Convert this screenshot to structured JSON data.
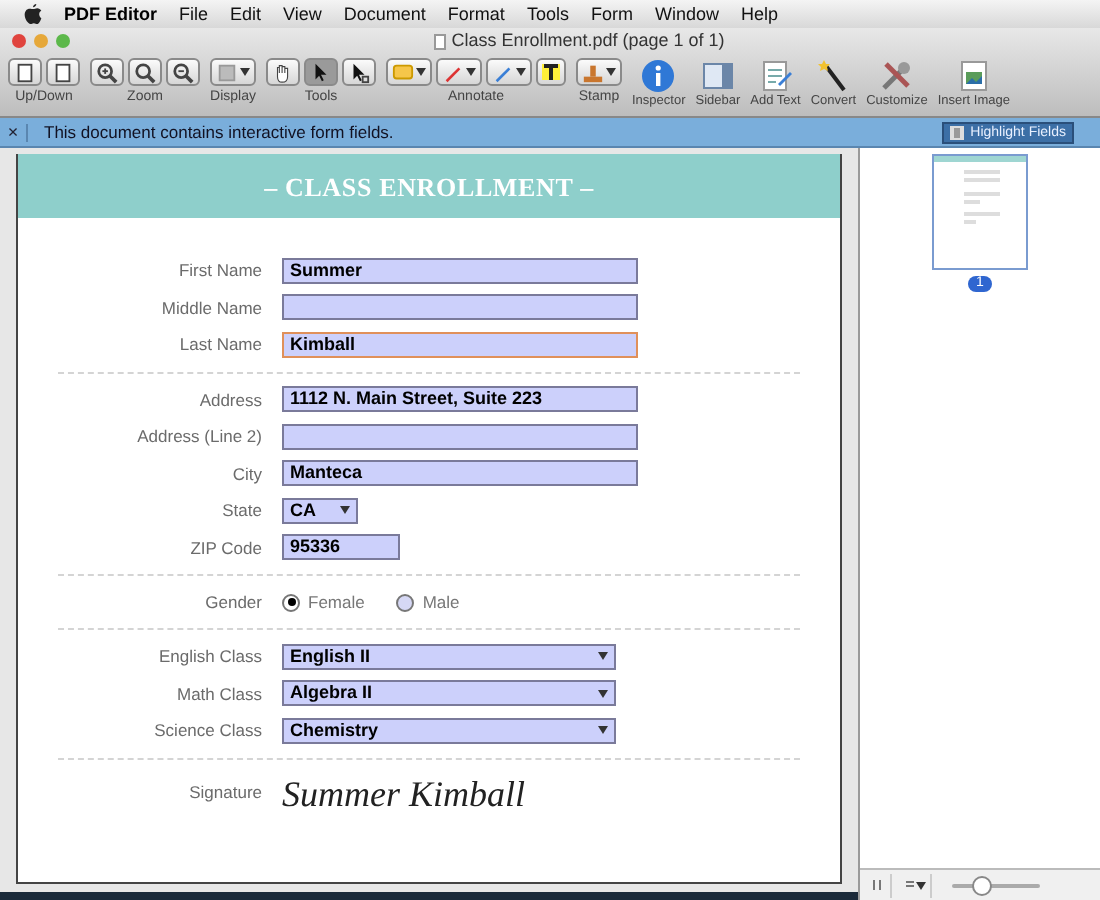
{
  "menu_bar": {
    "items": [
      {
        "label": "PDF Editor",
        "kind": "app"
      },
      {
        "label": "File",
        "kind": "menu"
      },
      {
        "label": "Edit",
        "kind": "menu"
      },
      {
        "label": "View",
        "kind": "menu"
      },
      {
        "label": "Document",
        "kind": "menu"
      },
      {
        "label": "Format",
        "kind": "menu"
      },
      {
        "label": "Tools",
        "kind": "menu"
      },
      {
        "label": "Form",
        "kind": "menu"
      },
      {
        "label": "Window",
        "kind": "menu"
      },
      {
        "label": "Help",
        "kind": "menu"
      }
    ]
  },
  "window": {
    "title": "Class Enrollment.pdf (page 1 of 1)"
  },
  "toolbar": {
    "groups": [
      {
        "label": "Up/Down",
        "kind": "updown",
        "buttons": [
          {
            "selected": false
          },
          {
            "selected": false
          }
        ]
      },
      {
        "label": "Zoom",
        "kind": "zoom",
        "buttons": [
          {
            "selected": false
          },
          {
            "selected": false
          },
          {
            "selected": false
          }
        ]
      },
      {
        "label": "Display",
        "kind": "display",
        "buttons": [
          {
            "selected": false
          }
        ]
      },
      {
        "label": "Tools",
        "kind": "tools",
        "buttons": [
          {
            "selected": false
          },
          {
            "selected": true
          },
          {
            "selected": false
          }
        ]
      },
      {
        "label": "Annotate",
        "kind": "annotate",
        "buttons": [
          {
            "selected": false
          },
          {
            "selected": false
          },
          {
            "selected": false
          },
          {
            "selected": false
          }
        ]
      },
      {
        "label": "Stamp",
        "kind": "stamp",
        "buttons": [
          {
            "selected": false
          }
        ]
      }
    ],
    "actions": [
      {
        "label": "Inspector",
        "kind": "inspector"
      },
      {
        "label": "Sidebar",
        "kind": "sidebar"
      },
      {
        "label": "Add Text",
        "kind": "addtext"
      },
      {
        "label": "Convert",
        "kind": "convert"
      },
      {
        "label": "Customize",
        "kind": "customize"
      },
      {
        "label": "Insert Image",
        "kind": "image"
      }
    ]
  },
  "info_bar": {
    "close": "×",
    "message": "This document contains interactive form fields.",
    "button": "Highlight Fields"
  },
  "form": {
    "title": "– CLASS ENROLLMENT –",
    "sections": [
      [
        {
          "kind": "text",
          "label": "First Name",
          "value": "Summer",
          "focused": false
        },
        {
          "kind": "text",
          "label": "Middle Name",
          "focused": false
        },
        {
          "kind": "text",
          "label": "Last Name",
          "value": "Kimball",
          "focused": true
        }
      ],
      [
        {
          "kind": "text",
          "label": "Address",
          "value": "1112 N. Main Street, Suite 223",
          "focused": false
        },
        {
          "kind": "text",
          "label": "Address (Line 2)",
          "focused": false
        },
        {
          "kind": "text",
          "label": "City",
          "value": "Manteca",
          "focused": false
        },
        {
          "kind": "short_select",
          "label": "State",
          "value": "CA"
        },
        {
          "kind": "short_text",
          "label": "ZIP Code",
          "value": "95336",
          "focused": false
        }
      ],
      [
        {
          "kind": "radio",
          "label": "Gender",
          "options": [
            {
              "label": "Female",
              "selected": true
            },
            {
              "label": "Male",
              "selected": false
            }
          ]
        }
      ],
      [
        {
          "kind": "select",
          "label": "English Class",
          "value": "English II"
        },
        {
          "kind": "select",
          "label": "Math Class",
          "value": "Algebra II"
        },
        {
          "kind": "select",
          "label": "Science Class",
          "value": "Chemistry"
        }
      ],
      [
        {
          "kind": "signature",
          "label": "Signature",
          "value": "Summer Kimball"
        }
      ]
    ]
  },
  "sidebar": {
    "pages": [
      {
        "label": "1",
        "selected": true
      }
    ],
    "zoom_slider": {
      "level": 0.35
    }
  }
}
